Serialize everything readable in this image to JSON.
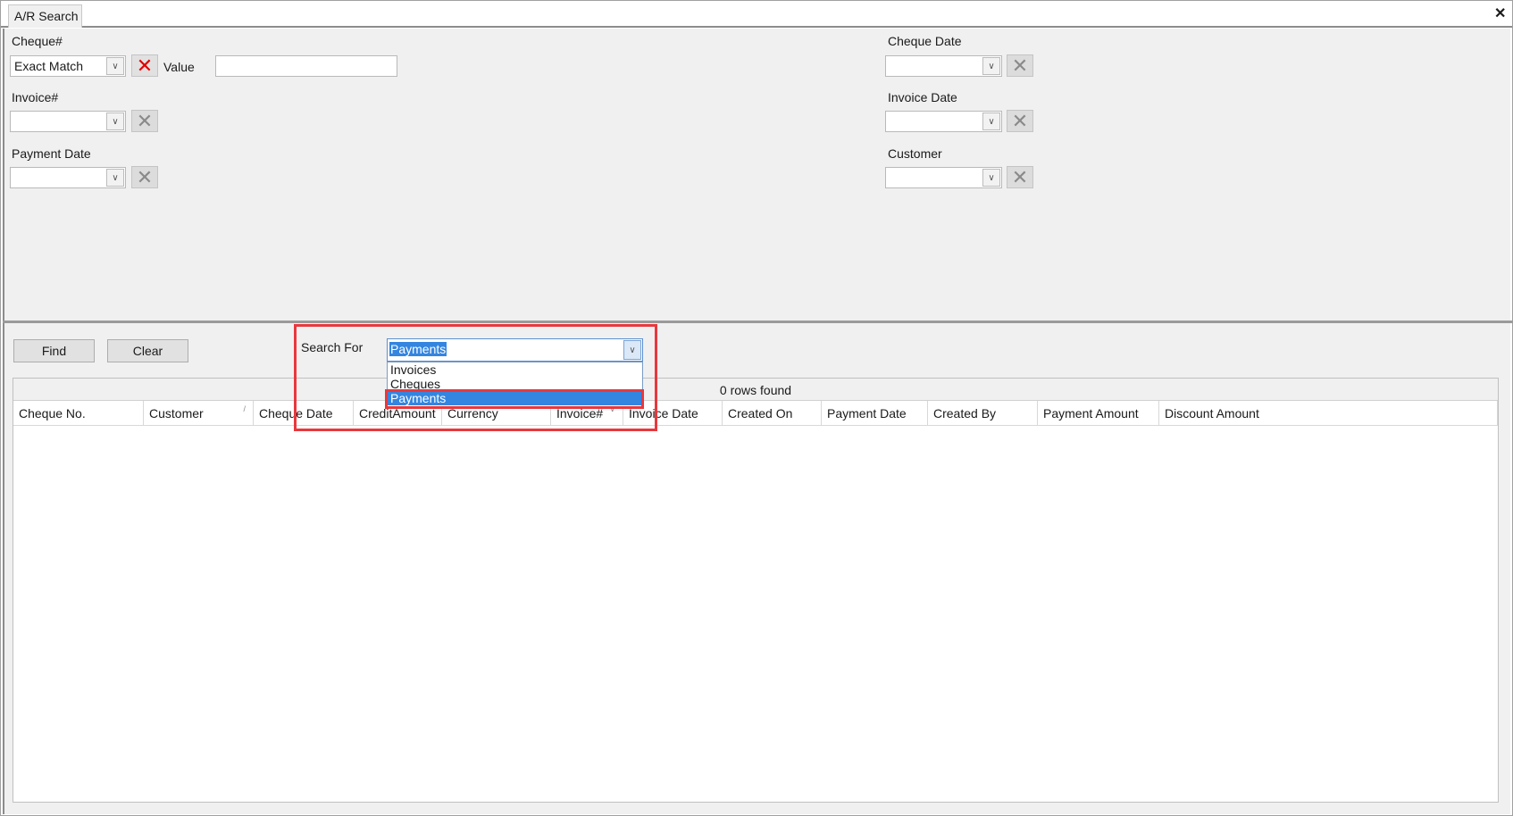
{
  "window": {
    "tab_title": "A/R Search",
    "close_icon": "close-icon"
  },
  "filters": {
    "cheque_no": {
      "label": "Cheque#",
      "mode": "Exact Match",
      "value_label": "Value",
      "value": ""
    },
    "invoice_no": {
      "label": "Invoice#",
      "mode": ""
    },
    "payment_date": {
      "label": "Payment Date",
      "mode": ""
    },
    "cheque_date": {
      "label": "Cheque Date",
      "mode": ""
    },
    "invoice_date": {
      "label": "Invoice Date",
      "mode": ""
    },
    "customer": {
      "label": "Customer",
      "mode": ""
    }
  },
  "actions": {
    "find_label": "Find",
    "clear_label": "Clear"
  },
  "search_for": {
    "label": "Search For",
    "selected": "Payments",
    "options": [
      "Invoices",
      "Cheques",
      "Payments"
    ]
  },
  "grid": {
    "status": "0 rows found",
    "columns": [
      "Cheque No.",
      "Customer",
      "Cheque Date",
      "CreditAmount",
      "Currency",
      "Invoice#",
      "Invoice Date",
      "Created On",
      "Payment Date",
      "Created By",
      "Payment Amount",
      "Discount Amount"
    ]
  },
  "colors": {
    "highlight": "#e8383d",
    "selection": "#3385e0",
    "clear_active": "#e00000"
  }
}
